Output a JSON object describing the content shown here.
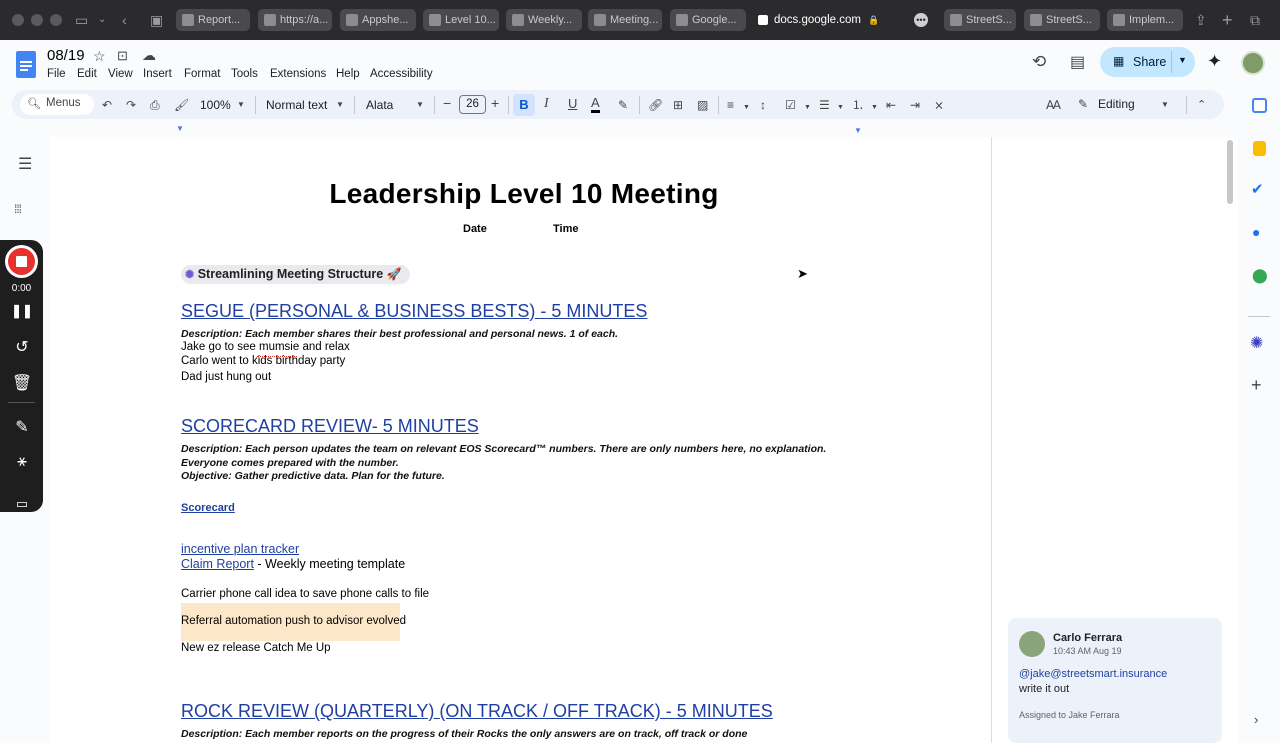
{
  "browser": {
    "tabs": [
      "Report...",
      "https://a...",
      "Appshe...",
      "Level 10...",
      "Weekly...",
      "Meeting...",
      "Google...",
      "StreetS...",
      "StreetS...",
      "Implem..."
    ],
    "url": "docs.google.com"
  },
  "doc": {
    "title": "08/19",
    "menus": [
      "File",
      "Edit",
      "View",
      "Insert",
      "Format",
      "Tools",
      "Extensions",
      "Help",
      "Accessibility"
    ],
    "share_label": "Share"
  },
  "toolbar": {
    "search_label": "Menus",
    "zoom": "100%",
    "style": "Normal text",
    "font": "Alata",
    "font_size": "26",
    "mode": "Editing"
  },
  "recorder": {
    "timer": "0:00"
  },
  "content": {
    "title": "Leadership Level 10 Meeting",
    "date_label": "Date",
    "time_label": "Time",
    "chip": "Streamlining Meeting Structure",
    "segue_heading": "SEGUE (PERSONAL & BUSINESS BESTS) - 5 MINUTES",
    "segue_desc": "Description: Each member shares their best professional and personal news. 1 of each.",
    "segue_lines": [
      "Jake go to see mumsie and relax",
      "Carlo went to kids birthday party",
      "Dad just hung out"
    ],
    "scorecard_heading": "SCORECARD REVIEW- 5 MINUTES",
    "scorecard_desc_1": "Description: Each person updates the team on relevant EOS Scorecard™ numbers. There are only numbers here, no explanation.",
    "scorecard_desc_2": "Everyone comes prepared with the number.",
    "scorecard_desc_3": "Objective: Gather predictive data. Plan for the future.",
    "scorecard_link": "Scorecard",
    "incentive_link": "incentive plan tracker",
    "claim_link": "Claim Report",
    "claim_suffix": " - Weekly meeting template",
    "line_carrier": "Carrier phone call idea to save phone calls to file",
    "line_referral": "Referral automation push to advisor evolved",
    "line_release": "New ez release Catch Me Up",
    "rock_heading": "ROCK REVIEW (QUARTERLY)  (ON TRACK / OFF TRACK) - 5 MINUTES",
    "rock_desc": "Description: Each member reports on the progress of their Rocks the only answers are on track, off track or done"
  },
  "comment": {
    "author": "Carlo Ferrara",
    "time": "10:43 AM Aug 19",
    "mention": "@jake@streetsmart.insurance",
    "text": "write it out",
    "assigned": "Assigned to Jake Ferrara"
  },
  "colors": {
    "share_bg": "#c2e7ff",
    "link": "#1f3fa3",
    "highlight": "#fce8c8",
    "record_red": "#e5322d"
  }
}
